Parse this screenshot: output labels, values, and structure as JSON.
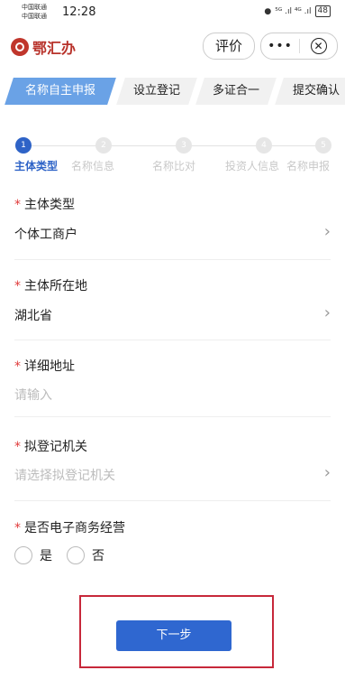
{
  "status_bar": {
    "carrier_1": "中国联通",
    "carrier_2": "中国联通",
    "time": "12:28",
    "network": "⁵ᴳ .ıl ⁴ᴳ .ıl",
    "battery": "48"
  },
  "header": {
    "logo_text": "鄂汇办",
    "eval_button": "评价",
    "more_label": "•••",
    "close_label": "✕"
  },
  "tabs": [
    {
      "label": "名称自主申报",
      "active": true
    },
    {
      "label": "设立登记",
      "active": false
    },
    {
      "label": "多证合一",
      "active": false
    },
    {
      "label": "提交确认",
      "active": false
    }
  ],
  "steps": [
    {
      "number": "1",
      "label": "主体类型",
      "active": true
    },
    {
      "number": "2",
      "label": "名称信息",
      "active": false
    },
    {
      "number": "3",
      "label": "名称比对",
      "active": false
    },
    {
      "number": "4",
      "label": "投资人信息",
      "active": false
    },
    {
      "number": "5",
      "label": "名称申报",
      "active": false
    }
  ],
  "form": {
    "entity_type": {
      "label": "主体类型",
      "value": "个体工商户"
    },
    "location": {
      "label": "主体所在地",
      "value": "湖北省"
    },
    "address": {
      "label": "详细地址",
      "placeholder": "请输入"
    },
    "authority": {
      "label": "拟登记机关",
      "placeholder": "请选择拟登记机关"
    },
    "ecommerce": {
      "label": "是否电子商务经营",
      "yes": "是",
      "no": "否"
    }
  },
  "required_mark": "*",
  "next_button": "下一步",
  "colors": {
    "primary": "#2f67d0",
    "tab_active": "#6aa2e6",
    "required": "#e03a3a",
    "highlight": "#c7283a",
    "logo": "#b8322a"
  }
}
